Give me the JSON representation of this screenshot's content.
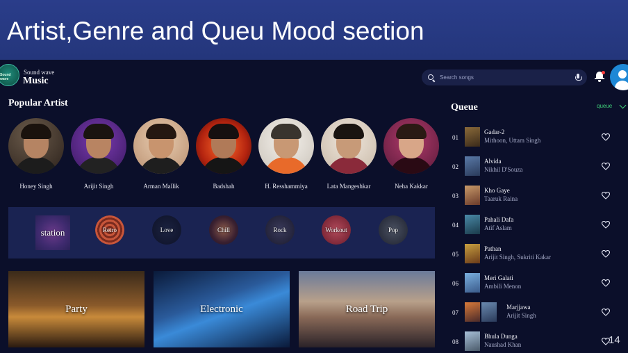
{
  "slide": {
    "title": "Artist,Genre and Queu Mood section",
    "page_number": "14"
  },
  "brand": {
    "subtitle": "Sound wave",
    "name": "Music",
    "logo_text": "Sound wave"
  },
  "search": {
    "placeholder": "Search songs"
  },
  "popular_artist": {
    "heading": "Popular Artist",
    "artists": [
      {
        "name": "Honey Singh"
      },
      {
        "name": "Arijit Singh"
      },
      {
        "name": "Arman Mallik"
      },
      {
        "name": "Badshah"
      },
      {
        "name": "H. Resshammiya"
      },
      {
        "name": "Lata Mangeshkar"
      },
      {
        "name": "Neha Kakkar"
      }
    ]
  },
  "genres": [
    {
      "label": "station"
    },
    {
      "label": "Retro"
    },
    {
      "label": "Love"
    },
    {
      "label": "Chill"
    },
    {
      "label": "Rock"
    },
    {
      "label": "Workout"
    },
    {
      "label": "Pop"
    }
  ],
  "moods": [
    {
      "label": "Party"
    },
    {
      "label": "Electronic"
    },
    {
      "label": "Road Trip"
    }
  ],
  "queue": {
    "heading": "Queue",
    "dropdown": "queue",
    "items": [
      {
        "num": "01",
        "title": "Gadar-2",
        "artist": "Mithoon, Uttam Singh"
      },
      {
        "num": "02",
        "title": "Alvida",
        "artist": "Nikhil D'Souza"
      },
      {
        "num": "03",
        "title": "Kho Gaye",
        "artist": "Taaruk Raina"
      },
      {
        "num": "04",
        "title": "Pahali Dafa",
        "artist": "Atif Aslam"
      },
      {
        "num": "05",
        "title": "Pathan",
        "artist": "Arijit Singh, Sukriti Kakar"
      },
      {
        "num": "06",
        "title": "Meri Galati",
        "artist": "Ambili Menon"
      },
      {
        "num": "07",
        "title": "Marjjawa",
        "artist": "Arijit Singh"
      },
      {
        "num": "08",
        "title": "Bhula Dunga",
        "artist": "Naushad Khan"
      }
    ]
  },
  "colors": {
    "accent_green": "#3fd17a",
    "header_blue": "#2a3d8a",
    "app_bg": "#0b0f2a",
    "notification_red": "#ff3b3b"
  }
}
